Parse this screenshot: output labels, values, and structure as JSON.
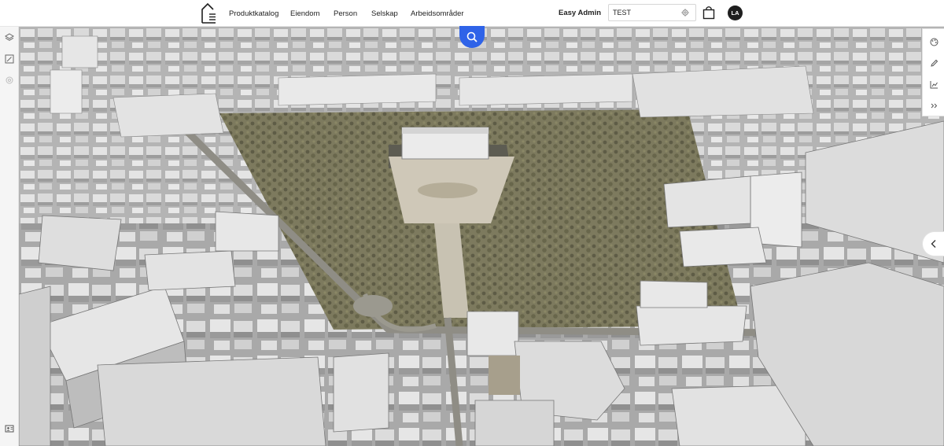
{
  "header": {
    "logo_icon": "house-document-icon",
    "nav": [
      {
        "label": "Produktkatalog"
      },
      {
        "label": "Eiendom"
      },
      {
        "label": "Person"
      },
      {
        "label": "Selskap"
      },
      {
        "label": "Arbeidsområder"
      }
    ],
    "user_name": "Easy Admin",
    "search": {
      "value": "TEST",
      "icon": "gear-icon"
    },
    "cart_icon": "shopping-bag-icon",
    "avatar_initials": "LA"
  },
  "left_toolbar": {
    "items": [
      {
        "icon": "layers-icon"
      },
      {
        "icon": "map-edit-icon"
      },
      {
        "icon": "settings-icon"
      },
      {
        "icon": "user-card-icon"
      }
    ]
  },
  "map": {
    "search_button_icon": "search-icon",
    "search_button_color": "#2f63e8",
    "right_tools": [
      {
        "icon": "palette-icon"
      },
      {
        "icon": "pencil-icon"
      },
      {
        "icon": "chart-icon"
      },
      {
        "icon": "double-chevron-right-icon"
      }
    ],
    "collapse_icon": "chevron-left-icon"
  }
}
